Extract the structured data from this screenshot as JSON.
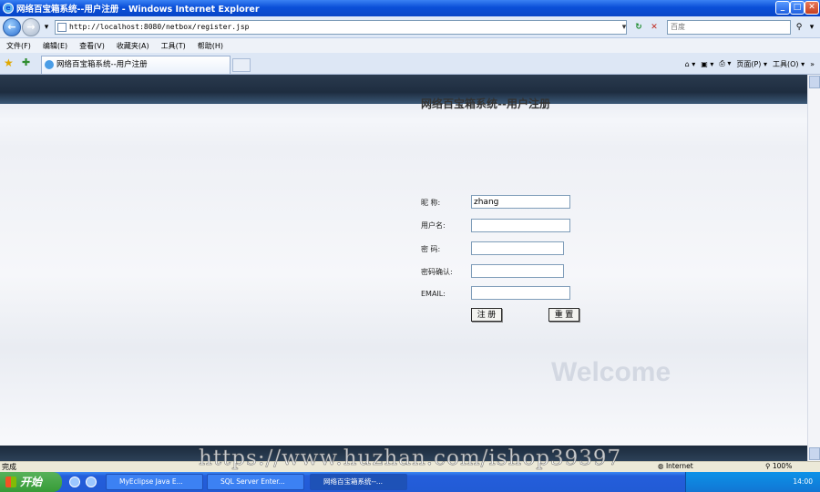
{
  "window": {
    "title": "网络百宝箱系统--用户注册 - Windows Internet Explorer",
    "min_label": "_",
    "max_label": "□",
    "close_label": "✕"
  },
  "address": {
    "back_label": "←",
    "forward_label": "→",
    "url": "http://localhost:8080/netbox/register.jsp",
    "search_placeholder": "百度",
    "refresh_label": "↻",
    "stop_label": "✕",
    "search_go_label": "⚲",
    "dropdown_label": "▾"
  },
  "menu": [
    "文件(F)",
    "编辑(E)",
    "查看(V)",
    "收藏夹(A)",
    "工具(T)",
    "帮助(H)"
  ],
  "tabs": {
    "active_label": "网络百宝箱系统--用户注册",
    "favorites_label": "★",
    "add_favorites_label": "✚"
  },
  "toolbar": {
    "home_label": "⌂ ▾",
    "feeds_label": "▣ ▾",
    "print_label": "⎙ ▾",
    "page_label": "页面(P) ▾",
    "tools_label": "工具(O) ▾",
    "more_label": "»"
  },
  "form": {
    "title": "网络百宝箱系统--用户注册",
    "nickname_label": "昵 称:",
    "nickname_value": "zhang",
    "username_label": "用户名:",
    "username_value": "",
    "password_label": "密 码:",
    "password_value": "",
    "confirm_label": "密码确认:",
    "confirm_value": "",
    "email_label": "EMAIL:",
    "email_value": "",
    "submit_label": "注 册",
    "reset_label": "重 置"
  },
  "background": {
    "welcome_text": "Welcome"
  },
  "status": {
    "text": "完成",
    "zone": "Internet",
    "zoom": "100%"
  },
  "watermark": "https://www.huzhan.com/ishop39397",
  "taskbar": {
    "start_label": "开始",
    "tasks": [
      "MyEclipse Java E...",
      "SQL Server Enter...",
      "网络百宝箱系统--..."
    ],
    "clock": "14:00"
  },
  "colors": {
    "titlebar": "#0a4fd8",
    "header_band": "#2a3a4e",
    "taskbar": "#245edb",
    "start_button": "#379b37"
  }
}
